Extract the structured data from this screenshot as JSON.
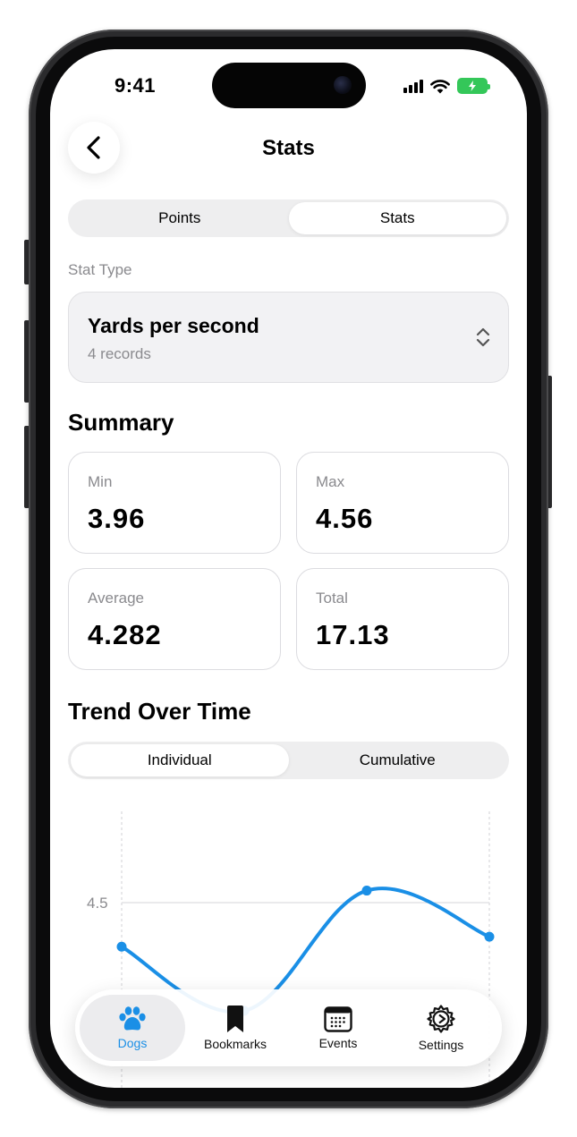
{
  "status_bar": {
    "time": "9:41"
  },
  "nav": {
    "title": "Stats"
  },
  "top_segment": {
    "options": [
      "Points",
      "Stats"
    ],
    "selected": "Stats"
  },
  "stat_type": {
    "label": "Stat Type",
    "value": "Yards per second",
    "subtitle": "4 records"
  },
  "summary": {
    "title": "Summary",
    "cards": [
      {
        "label": "Min",
        "value": "3.96"
      },
      {
        "label": "Max",
        "value": "4.56"
      },
      {
        "label": "Average",
        "value": "4.282"
      },
      {
        "label": "Total",
        "value": "17.13"
      }
    ]
  },
  "trend": {
    "title": "Trend Over Time",
    "options": [
      "Individual",
      "Cumulative"
    ],
    "selected": "Individual"
  },
  "chart_data": {
    "type": "line",
    "x": [
      1,
      2,
      3,
      4
    ],
    "series": [
      {
        "values": [
          4.28,
          3.96,
          4.56,
          4.33
        ]
      }
    ],
    "y_tick_labels": [
      "4.5"
    ],
    "color": "#1a8fe6"
  },
  "tab_bar": {
    "items": [
      {
        "label": "Dogs",
        "icon": "paw-icon"
      },
      {
        "label": "Bookmarks",
        "icon": "bookmark-icon"
      },
      {
        "label": "Events",
        "icon": "calendar-icon"
      },
      {
        "label": "Settings",
        "icon": "gear-icon"
      }
    ],
    "selected": "Dogs",
    "accent": "#1a8fe6"
  }
}
